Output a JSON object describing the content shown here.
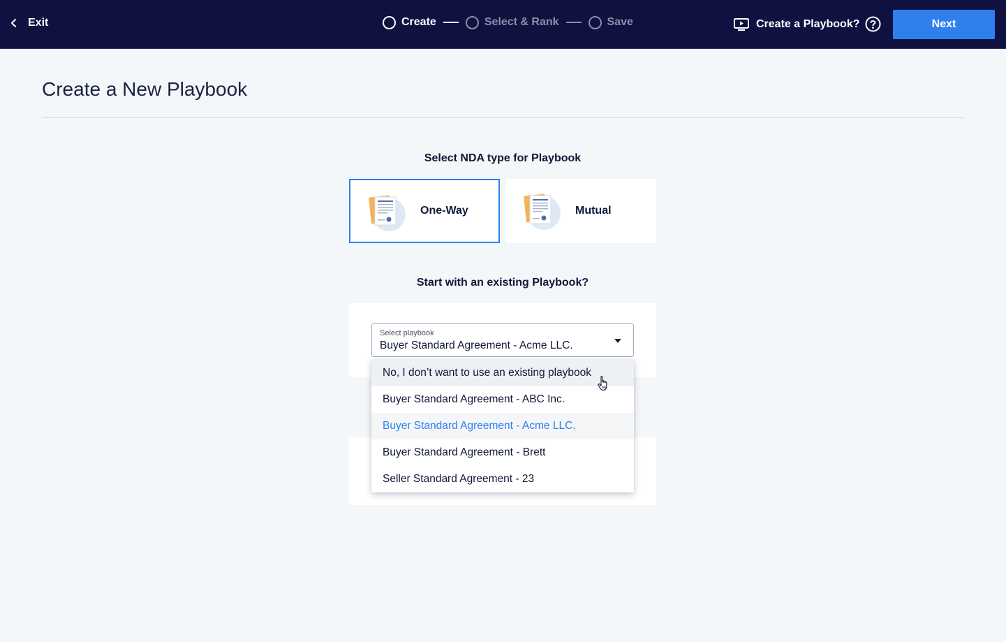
{
  "topbar": {
    "exit_label": "Exit",
    "steps": [
      {
        "label": "Create",
        "state": "active"
      },
      {
        "label": "Select & Rank",
        "state": "inactive"
      },
      {
        "label": "Save",
        "state": "inactive"
      }
    ],
    "help_label": "Create a Playbook?",
    "next_label": "Next"
  },
  "page": {
    "title": "Create a New Playbook"
  },
  "nda": {
    "heading": "Select NDA type for Playbook",
    "options": [
      {
        "label": "One-Way",
        "selected": true
      },
      {
        "label": "Mutual",
        "selected": false
      }
    ]
  },
  "playbook": {
    "heading": "Start with an existing Playbook?",
    "select_label": "Select playbook",
    "select_value": "Buyer Standard Agreement - Acme LLC.",
    "options": [
      {
        "label": "No, I don’t want to use an existing playbook",
        "state": "hover"
      },
      {
        "label": "Buyer Standard Agreement - ABC Inc.",
        "state": "normal"
      },
      {
        "label": "Buyer Standard Agreement - Acme LLC.",
        "state": "selected"
      },
      {
        "label": "Buyer Standard Agreement - Brett",
        "state": "normal"
      },
      {
        "label": "Seller Standard Agreement - 23",
        "state": "normal"
      }
    ]
  },
  "colors": {
    "topbar": "#0f1240",
    "accent": "#2f80ed",
    "background": "#f4f7fa"
  }
}
